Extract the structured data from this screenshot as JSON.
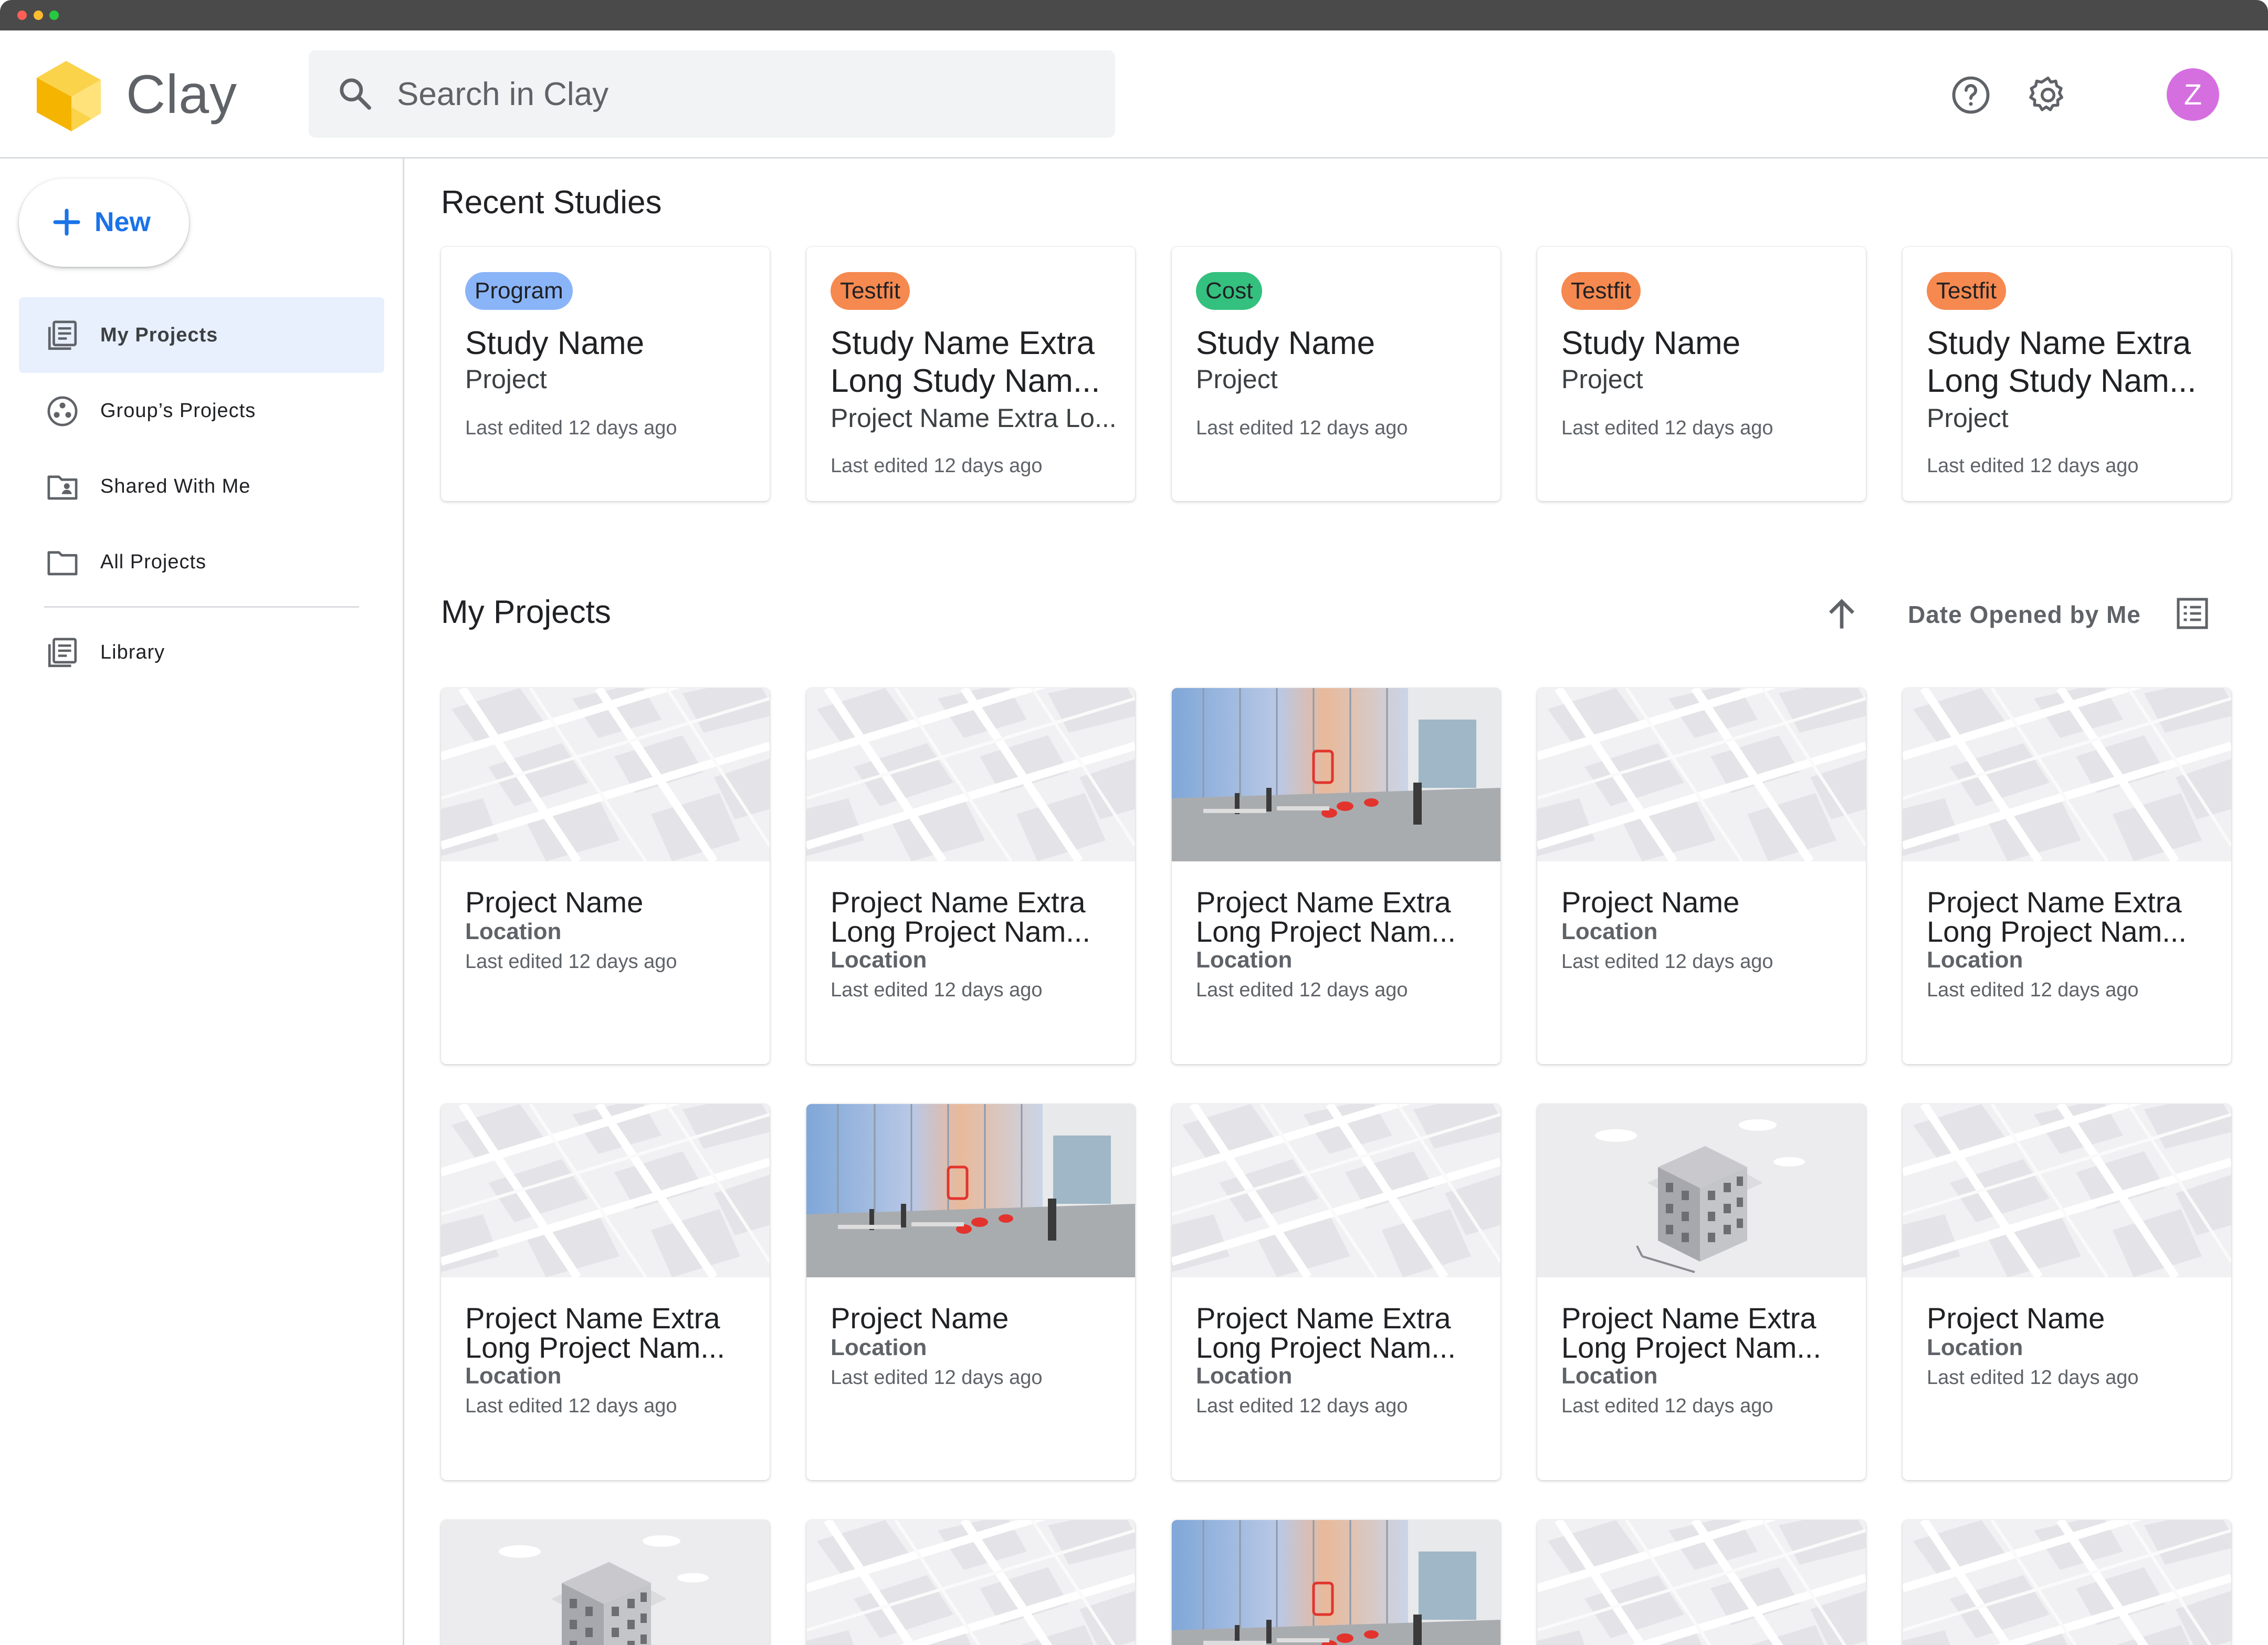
{
  "app": {
    "name": "Clay"
  },
  "search": {
    "placeholder": "Search in Clay"
  },
  "user": {
    "initial": "Z"
  },
  "colors": {
    "accent": "#1a73e8",
    "nav_active_bg": "#e8f0fe",
    "avatar": "#d56fe0",
    "tag_program": "#8ab4f8",
    "tag_testfit": "#f6894f",
    "tag_cost": "#34c07e"
  },
  "sidebar": {
    "new_label": "New",
    "items": [
      {
        "label": "My Projects",
        "icon": "projects-list-icon",
        "active": true
      },
      {
        "label": "Group’s Projects",
        "icon": "group-icon",
        "active": false
      },
      {
        "label": "Shared With Me",
        "icon": "shared-folder-icon",
        "active": false
      },
      {
        "label": "All Projects",
        "icon": "folder-icon",
        "active": false
      },
      {
        "label": "Library",
        "icon": "library-icon",
        "active": false
      }
    ]
  },
  "recent": {
    "title": "Recent Studies",
    "studies": [
      {
        "tag": "Program",
        "name_line1": "Study Name",
        "name_line2": "",
        "project": "Project",
        "edited": "Last edited 12 days ago"
      },
      {
        "tag": "Testfit",
        "name_line1": "Study Name Extra",
        "name_line2": "Long Study Nam...",
        "project": "Project Name Extra Lo...",
        "edited": "Last edited 12 days ago"
      },
      {
        "tag": "Cost",
        "name_line1": "Study Name",
        "name_line2": "",
        "project": "Project",
        "edited": "Last edited 12 days ago"
      },
      {
        "tag": "Testfit",
        "name_line1": "Study Name",
        "name_line2": "",
        "project": "Project",
        "edited": "Last edited 12 days ago"
      },
      {
        "tag": "Testfit",
        "name_line1": "Study Name Extra",
        "name_line2": "Long Study Nam...",
        "project": "Project",
        "edited": "Last edited 12 days ago"
      }
    ]
  },
  "projects": {
    "title": "My Projects",
    "sort_label": "Date Opened by Me",
    "items": [
      {
        "line1": "Project Name",
        "line2": "",
        "location": "Location",
        "edited": "Last edited 12 days ago",
        "thumb": "map"
      },
      {
        "line1": "Project Name Extra",
        "line2": "Long Project Nam...",
        "location": "Location",
        "edited": "Last edited 12 days ago",
        "thumb": "map"
      },
      {
        "line1": "Project Name Extra",
        "line2": "Long Project Nam...",
        "location": "Location",
        "edited": "Last edited 12 days ago",
        "thumb": "photo"
      },
      {
        "line1": "Project Name",
        "line2": "",
        "location": "Location",
        "edited": "Last edited 12 days ago",
        "thumb": "map"
      },
      {
        "line1": "Project Name Extra",
        "line2": "Long Project Nam...",
        "location": "Location",
        "edited": "Last edited 12 days ago",
        "thumb": "map"
      },
      {
        "line1": "Project Name Extra",
        "line2": "Long Project Nam...",
        "location": "Location",
        "edited": "Last edited 12 days ago",
        "thumb": "map"
      },
      {
        "line1": "Project Name",
        "line2": "",
        "location": "Location",
        "edited": "Last edited 12 days ago",
        "thumb": "photo"
      },
      {
        "line1": "Project Name Extra",
        "line2": "Long Project Nam...",
        "location": "Location",
        "edited": "Last edited 12 days ago",
        "thumb": "map"
      },
      {
        "line1": "Project Name Extra",
        "line2": "Long Project Nam...",
        "location": "Location",
        "edited": "Last edited 12 days ago",
        "thumb": "building"
      },
      {
        "line1": "Project Name",
        "line2": "",
        "location": "Location",
        "edited": "Last edited 12 days ago",
        "thumb": "map"
      },
      {
        "thumb": "building"
      },
      {
        "thumb": "map"
      },
      {
        "thumb": "photo"
      },
      {
        "thumb": "map"
      },
      {
        "thumb": "map"
      }
    ]
  }
}
